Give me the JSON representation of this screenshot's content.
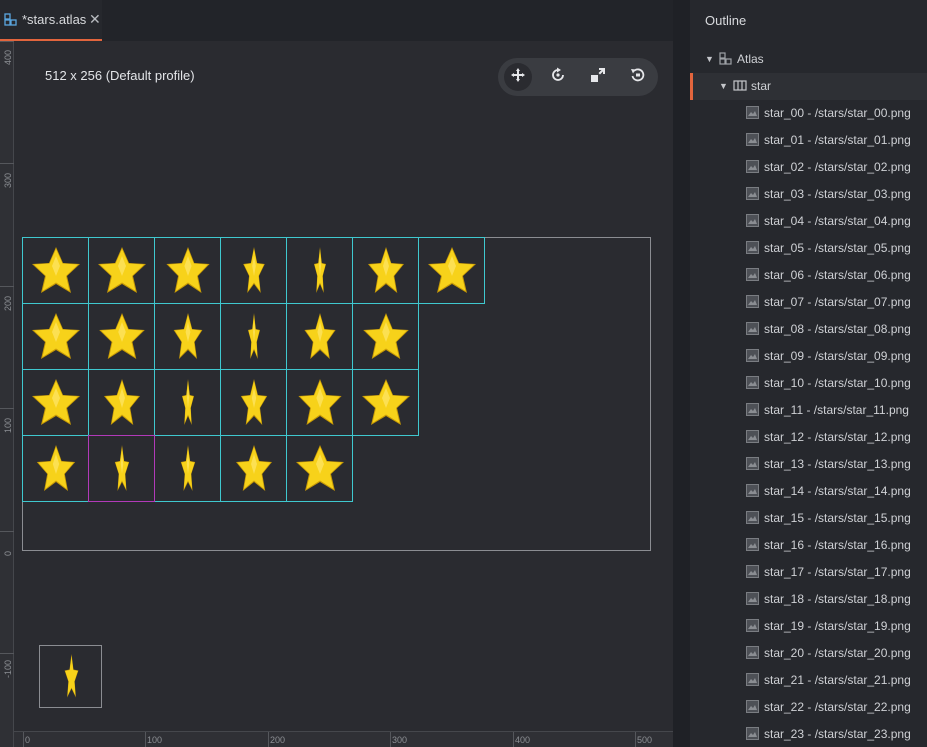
{
  "tab": {
    "title": "*stars.atlas",
    "close": "✕"
  },
  "editor": {
    "profile_label": "512 x 256 (Default profile)",
    "ruler_left": [
      "400",
      "300",
      "200",
      "100",
      "0",
      "-100"
    ],
    "ruler_bottom": [
      "0",
      "100",
      "200",
      "300",
      "400",
      "500"
    ],
    "tools": [
      "move-tool",
      "rotate-tool",
      "scale-tool",
      "reset-view-tool"
    ]
  },
  "outline": {
    "title": "Outline",
    "root": {
      "label": "Atlas",
      "arrow": "▼"
    },
    "group": {
      "label": "star",
      "arrow": "▼"
    },
    "items": [
      "star_00 - /stars/star_00.png",
      "star_01 - /stars/star_01.png",
      "star_02 - /stars/star_02.png",
      "star_03 - /stars/star_03.png",
      "star_04 - /stars/star_04.png",
      "star_05 - /stars/star_05.png",
      "star_06 - /stars/star_06.png",
      "star_07 - /stars/star_07.png",
      "star_08 - /stars/star_08.png",
      "star_09 - /stars/star_09.png",
      "star_10 - /stars/star_10.png",
      "star_11 - /stars/star_11.png",
      "star_12 - /stars/star_12.png",
      "star_13 - /stars/star_13.png",
      "star_14 - /stars/star_14.png",
      "star_15 - /stars/star_15.png",
      "star_16 - /stars/star_16.png",
      "star_17 - /stars/star_17.png",
      "star_18 - /stars/star_18.png",
      "star_19 - /stars/star_19.png",
      "star_20 - /stars/star_20.png",
      "star_21 - /stars/star_21.png",
      "star_22 - /stars/star_22.png",
      "star_23 - /stars/star_23.png"
    ]
  },
  "atlas": {
    "rows": [
      7,
      6,
      6,
      5
    ],
    "selected_index": 20,
    "star_widths": [
      1.0,
      1.0,
      0.9,
      0.45,
      0.25,
      0.75,
      1.0,
      1.0,
      0.95,
      0.6,
      0.25,
      0.65,
      0.95,
      1.0,
      0.75,
      0.25,
      0.55,
      0.9,
      1.0,
      0.8,
      0.3,
      0.3,
      0.75,
      1.0
    ],
    "colors": {
      "frame": "#3fc8cf",
      "selected_frame": "#b23ab9",
      "star_fill": "#f7d21a",
      "star_dark": "#c79a06",
      "accent": "#e2653d"
    }
  }
}
